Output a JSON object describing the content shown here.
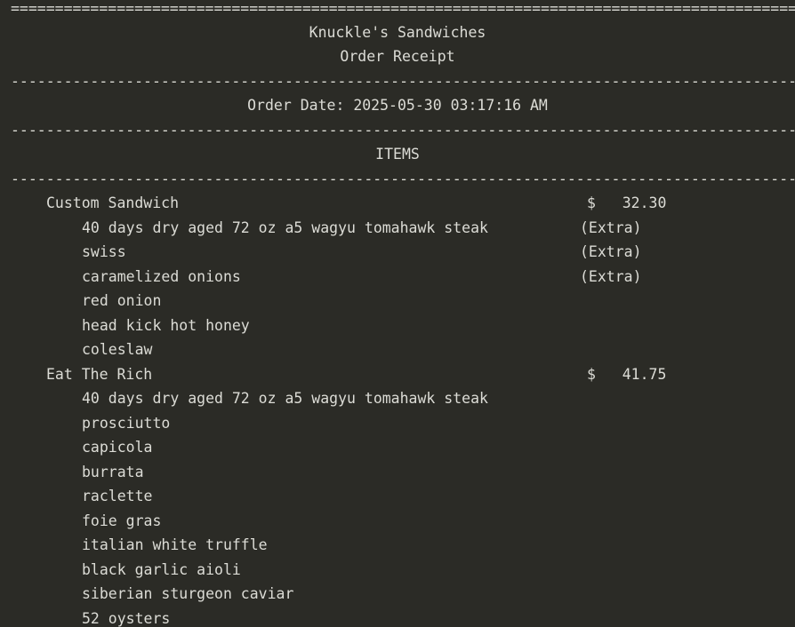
{
  "receipt": {
    "rule_double": "============================================================================================",
    "rule_single": "--------------------------------------------------------------------------------------------",
    "shop_name": "Knuckle's Sandwiches",
    "subtitle": "Order Receipt",
    "order_date": "Order Date: 2025-05-30 03:17:16 AM",
    "items_header": "ITEMS",
    "items": [
      {
        "name": "Custom Sandwich",
        "price": "$   32.30",
        "toppings": [
          {
            "name": "40 days dry aged 72 oz a5 wagyu tomahawk steak",
            "tag": "(Extra)"
          },
          {
            "name": "swiss",
            "tag": "(Extra)"
          },
          {
            "name": "caramelized onions",
            "tag": "(Extra)"
          },
          {
            "name": "red onion",
            "tag": ""
          },
          {
            "name": "head kick hot honey",
            "tag": ""
          },
          {
            "name": "coleslaw",
            "tag": ""
          }
        ]
      },
      {
        "name": "Eat The Rich",
        "price": "$   41.75",
        "toppings": [
          {
            "name": "40 days dry aged 72 oz a5 wagyu tomahawk steak",
            "tag": ""
          },
          {
            "name": "prosciutto",
            "tag": ""
          },
          {
            "name": "capicola",
            "tag": ""
          },
          {
            "name": "burrata",
            "tag": ""
          },
          {
            "name": "raclette",
            "tag": ""
          },
          {
            "name": "foie gras",
            "tag": ""
          },
          {
            "name": "italian white truffle",
            "tag": ""
          },
          {
            "name": "black garlic aioli",
            "tag": ""
          },
          {
            "name": "siberian sturgeon caviar",
            "tag": ""
          },
          {
            "name": "52 oysters",
            "tag": ""
          }
        ]
      }
    ]
  }
}
